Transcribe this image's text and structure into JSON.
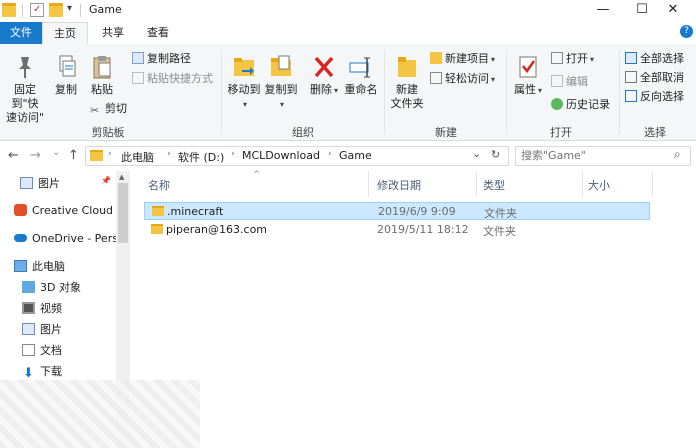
{
  "window": {
    "title": "Game",
    "minimize_glyph": "—",
    "maximize_glyph": "☐",
    "close_glyph": "✕",
    "qa_dropdown_glyph": "▾"
  },
  "tabs": [
    {
      "label": "文件"
    },
    {
      "label": "主页"
    },
    {
      "label": "共享"
    },
    {
      "label": "查看"
    }
  ],
  "help_glyph": "?",
  "ribbon": {
    "clipboard": {
      "label": "剪贴板",
      "pin": "固定到\"快\n速访问\"",
      "copy": "复制",
      "paste": "粘贴",
      "copy_path": "复制路径",
      "paste_shortcut": "粘贴快捷方式",
      "cut": "剪切"
    },
    "organize": {
      "label": "组织",
      "move_to": "移动到",
      "copy_to": "复制到",
      "delete": "删除",
      "rename": "重命名"
    },
    "new": {
      "label": "新建",
      "new_folder": "新建\n文件夹",
      "new_item": "新建项目",
      "easy_access": "轻松访问"
    },
    "open": {
      "label": "打开",
      "properties": "属性",
      "open": "打开",
      "edit": "编辑",
      "history": "历史记录"
    },
    "select": {
      "label": "选择",
      "select_all": "全部选择",
      "select_none": "全部取消",
      "invert": "反向选择"
    }
  },
  "address": {
    "back": "←",
    "forward": "→",
    "recent": "⌄",
    "up": "↑",
    "crumbs": [
      "此电脑",
      "软件 (D:)",
      "MCLDownload",
      "Game"
    ],
    "crumb_sep": "›",
    "dropdown": "⌄",
    "refresh": "↻"
  },
  "search": {
    "placeholder": "搜索\"Game\"",
    "icon": "⌕"
  },
  "nav": {
    "pin_glyph": "📌",
    "items": [
      {
        "label": "图片"
      },
      {
        "label": "Creative Cloud Files"
      },
      {
        "label": "OneDrive - Personal"
      },
      {
        "label": "此电脑"
      },
      {
        "label": "3D 对象"
      },
      {
        "label": "视频"
      },
      {
        "label": "图片"
      },
      {
        "label": "文档"
      },
      {
        "label": "下载"
      }
    ]
  },
  "list": {
    "sort_glyph": "^",
    "columns": [
      "名称",
      "修改日期",
      "类型",
      "大小"
    ],
    "rows": [
      {
        "name": ".minecraft",
        "date": "2019/6/9 9:09",
        "type": "文件夹",
        "size": ""
      },
      {
        "name": "piperan@163.com",
        "date": "2019/5/11 18:12",
        "type": "文件夹",
        "size": ""
      }
    ]
  },
  "colors": {
    "accent": "#1979ca",
    "selection": "#cce8ff",
    "folder": "#f4c542"
  }
}
